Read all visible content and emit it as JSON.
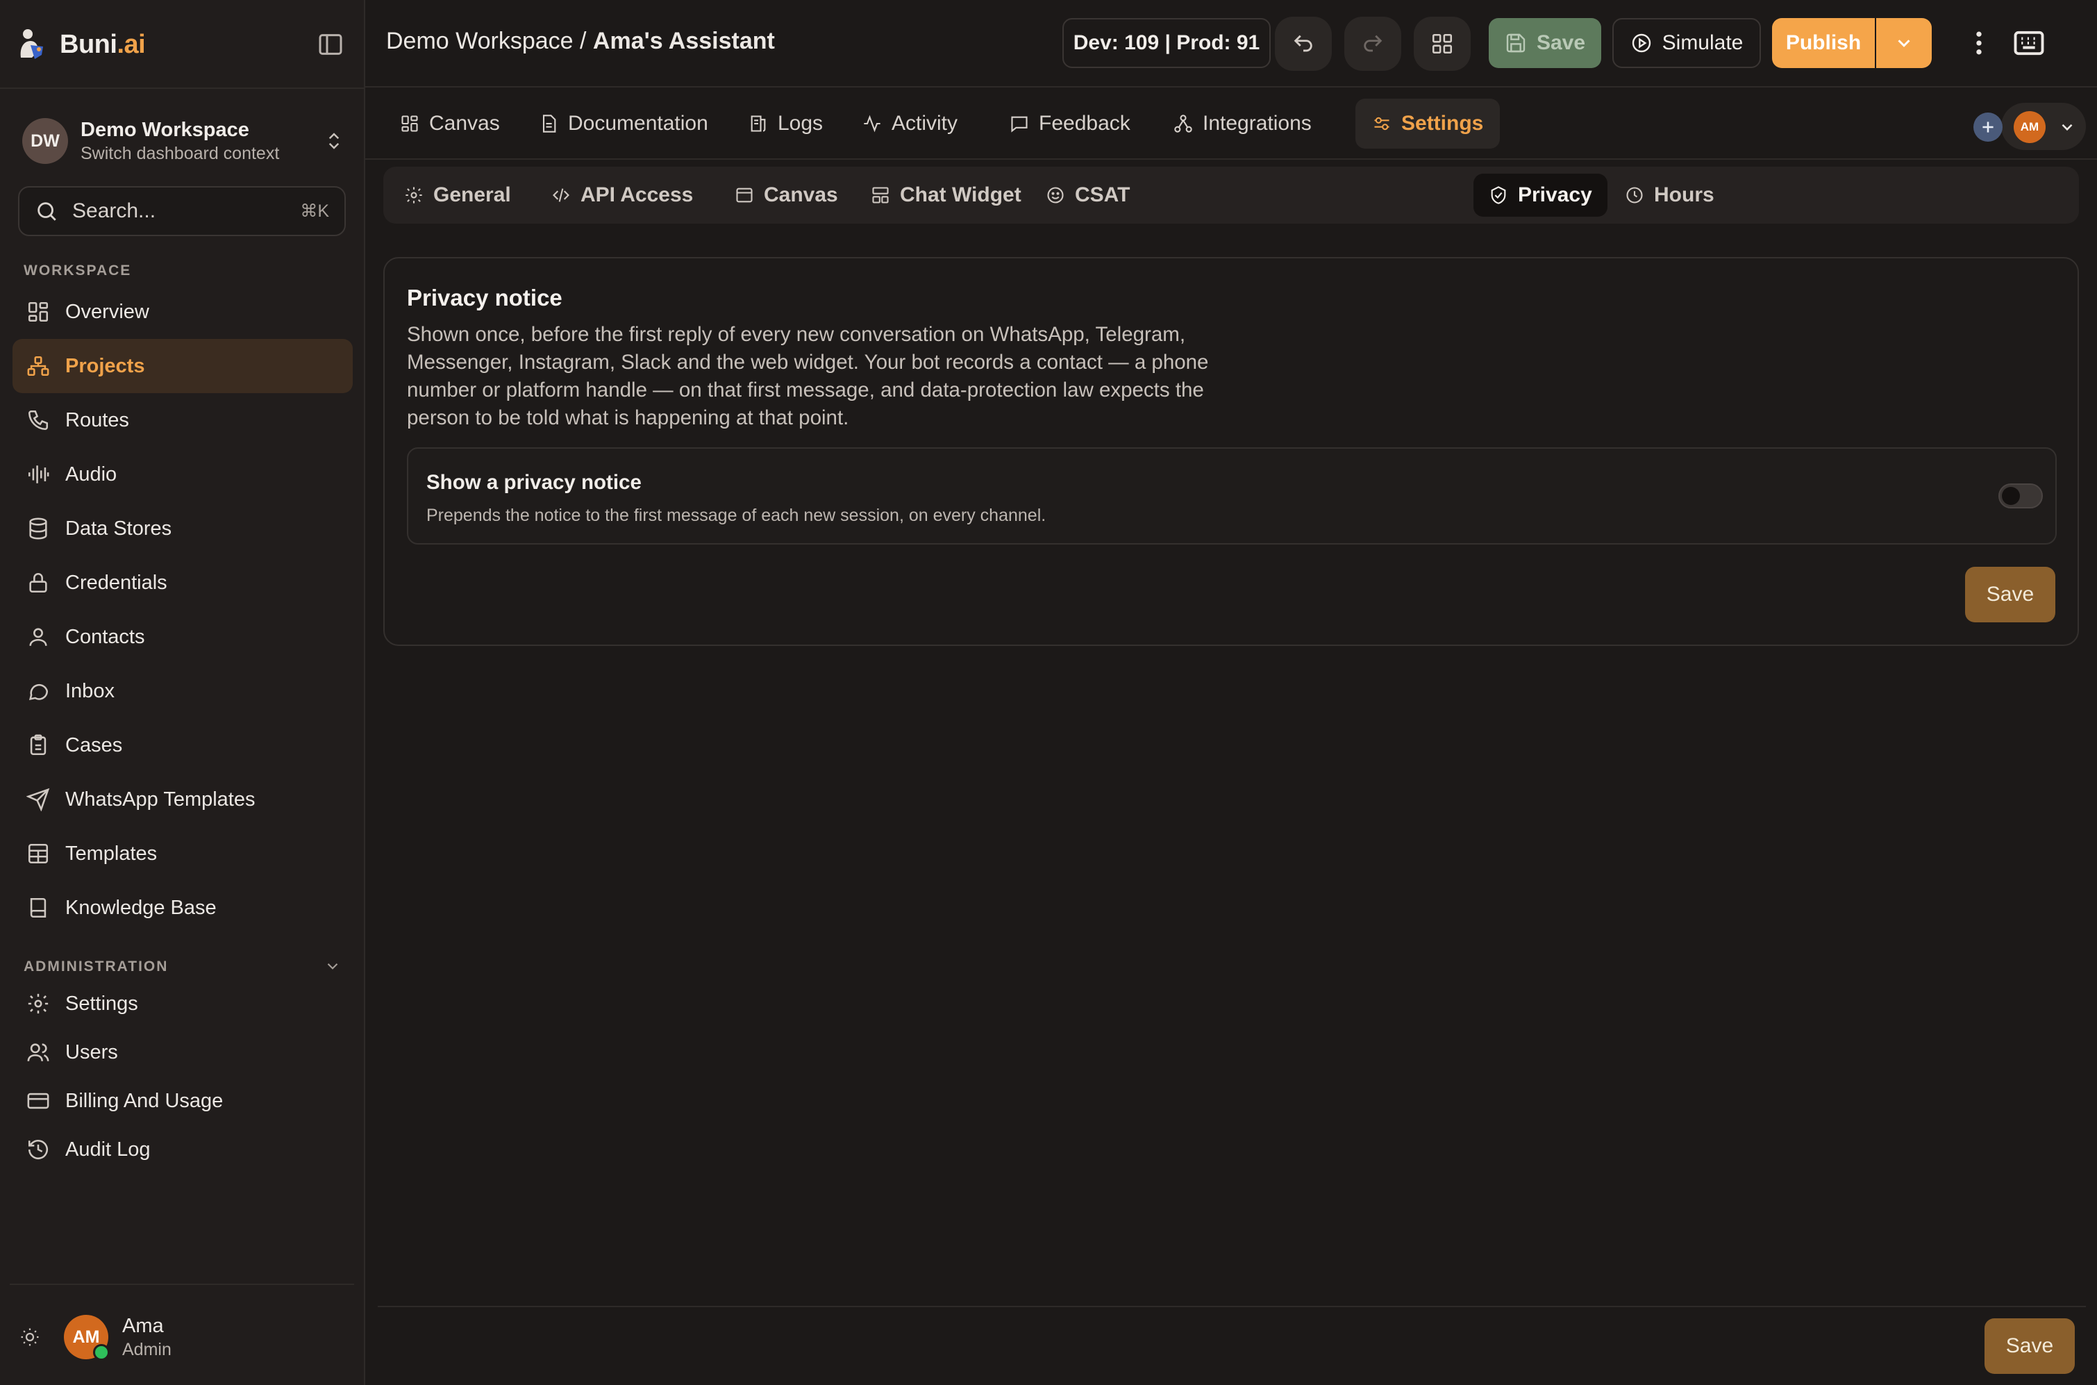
{
  "brand": {
    "name": "Buni",
    "suffix": ".ai"
  },
  "workspace": {
    "initials": "DW",
    "name": "Demo Workspace",
    "subtitle": "Switch dashboard context"
  },
  "search": {
    "placeholder": "Search...",
    "shortcut": "⌘K"
  },
  "sidebar": {
    "workspace_label": "WORKSPACE",
    "items": [
      {
        "label": "Overview",
        "icon": "grid-icon"
      },
      {
        "label": "Projects",
        "icon": "projects-icon",
        "active": true
      },
      {
        "label": "Routes",
        "icon": "phone-icon"
      },
      {
        "label": "Audio",
        "icon": "audio-wave-icon"
      },
      {
        "label": "Data Stores",
        "icon": "database-icon"
      },
      {
        "label": "Credentials",
        "icon": "lock-icon"
      },
      {
        "label": "Contacts",
        "icon": "user-icon"
      },
      {
        "label": "Inbox",
        "icon": "chat-bubble-icon"
      },
      {
        "label": "Cases",
        "icon": "clipboard-icon"
      },
      {
        "label": "WhatsApp Templates",
        "icon": "send-icon"
      },
      {
        "label": "Templates",
        "icon": "layout-icon"
      },
      {
        "label": "Knowledge Base",
        "icon": "book-icon"
      }
    ],
    "admin_label": "ADMINISTRATION",
    "admin_items": [
      {
        "label": "Settings",
        "icon": "gear-icon"
      },
      {
        "label": "Users",
        "icon": "users-icon"
      },
      {
        "label": "Billing And Usage",
        "icon": "credit-card-icon"
      },
      {
        "label": "Audit Log",
        "icon": "history-icon"
      }
    ]
  },
  "user": {
    "initials": "AM",
    "name": "Ama",
    "role": "Admin"
  },
  "header": {
    "breadcrumb_workspace": "Demo Workspace / ",
    "breadcrumb_project": "Ama's Assistant",
    "version_counts": "Dev: 109 | Prod: 91",
    "save_label": "Save",
    "simulate_label": "Simulate",
    "publish_label": "Publish"
  },
  "tabs": [
    {
      "label": "Canvas",
      "icon": "grid-icon"
    },
    {
      "label": "Documentation",
      "icon": "document-icon"
    },
    {
      "label": "Logs",
      "icon": "logs-icon"
    },
    {
      "label": "Activity",
      "icon": "activity-icon"
    },
    {
      "label": "Feedback",
      "icon": "message-square-icon"
    },
    {
      "label": "Integrations",
      "icon": "integrations-icon"
    },
    {
      "label": "Settings",
      "icon": "settings-sliders-icon",
      "active": true
    }
  ],
  "collaborator": {
    "initials": "AM"
  },
  "subtabs": [
    {
      "label": "General",
      "icon": "gear-icon"
    },
    {
      "label": "API Access",
      "icon": "code-icon"
    },
    {
      "label": "Canvas",
      "icon": "canvas-icon"
    },
    {
      "label": "Chat Widget",
      "icon": "widget-icon"
    },
    {
      "label": "CSAT",
      "icon": "smile-icon"
    },
    {
      "label": "Privacy",
      "icon": "shield-check-icon",
      "active": true
    },
    {
      "label": "Hours",
      "icon": "clock-icon"
    }
  ],
  "privacy": {
    "title": "Privacy notice",
    "description": "Shown once, before the first reply of every new conversation on WhatsApp, Telegram, Messenger, Instagram, Slack and the web widget. Your bot records a contact — a phone number or platform handle — on that first message, and data-protection law expects the person to be told what is happening at that point.",
    "toggle_title": "Show a privacy notice",
    "toggle_description": "Prepends the notice to the first message of each new session, on every channel.",
    "toggle_on": false,
    "save_label": "Save"
  },
  "footer": {
    "save_label": "Save"
  },
  "colors": {
    "accent": "#f0a24a",
    "background": "#1c1918",
    "sidebar": "#211d1c",
    "publish": "#f5a54a",
    "save": "#8a5f2c"
  }
}
